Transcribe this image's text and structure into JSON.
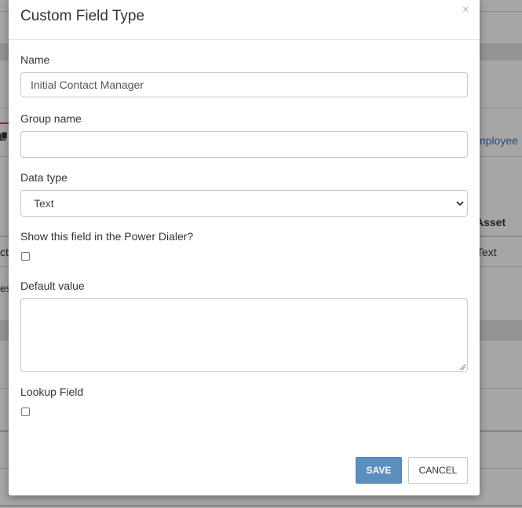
{
  "background": {
    "link_fragment": "mployee",
    "column_header_fragment": "Asset",
    "row_left_fragment": "ct",
    "row_value_fragment": "Text",
    "row2_left_fragment": "es)"
  },
  "modal": {
    "title": "Custom Field Type",
    "close_label": "×",
    "fields": {
      "name": {
        "label": "Name",
        "value": "Initial Contact Manager"
      },
      "group_name": {
        "label": "Group name",
        "value": ""
      },
      "data_type": {
        "label": "Data type",
        "selected": "Text"
      },
      "power_dialer": {
        "label": "Show this field in the Power Dialer?",
        "checked": false
      },
      "default_value": {
        "label": "Default value",
        "value": ""
      },
      "lookup_field": {
        "label": "Lookup Field",
        "checked": false
      }
    },
    "buttons": {
      "save": "SAVE",
      "cancel": "CANCEL"
    }
  }
}
